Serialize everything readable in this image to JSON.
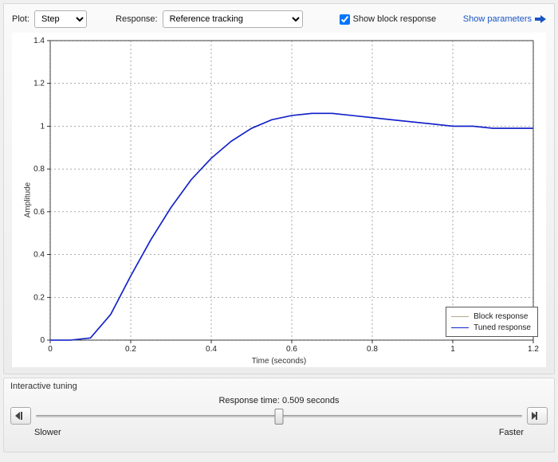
{
  "toolbar": {
    "plot_label": "Plot:",
    "plot_value": "Step",
    "response_label": "Response:",
    "response_value": "Reference tracking",
    "show_block_label": "Show block response",
    "show_block_checked": true,
    "show_params_label": "Show parameters"
  },
  "chart_data": {
    "type": "line",
    "title": "",
    "xlabel": "Time (seconds)",
    "ylabel": "Amplitude",
    "xlim": [
      0,
      1.2
    ],
    "ylim": [
      0,
      1.4
    ],
    "x": [
      0,
      0.05,
      0.1,
      0.15,
      0.2,
      0.25,
      0.3,
      0.35,
      0.4,
      0.45,
      0.5,
      0.55,
      0.6,
      0.65,
      0.7,
      0.75,
      0.8,
      0.85,
      0.9,
      0.95,
      1.0,
      1.05,
      1.1,
      1.15,
      1.2
    ],
    "series": [
      {
        "name": "Block response",
        "color": "#b8a98e",
        "values": [
          0,
          0,
          0.01,
          0.12,
          0.3,
          0.47,
          0.62,
          0.75,
          0.85,
          0.93,
          0.99,
          1.03,
          1.05,
          1.06,
          1.06,
          1.05,
          1.04,
          1.03,
          1.02,
          1.01,
          1.0,
          1.0,
          0.99,
          0.99,
          0.99
        ]
      },
      {
        "name": "Tuned response",
        "color": "#1020d0",
        "values": [
          0,
          0,
          0.01,
          0.12,
          0.3,
          0.47,
          0.62,
          0.75,
          0.85,
          0.93,
          0.99,
          1.03,
          1.05,
          1.06,
          1.06,
          1.05,
          1.04,
          1.03,
          1.02,
          1.01,
          1.0,
          1.0,
          0.99,
          0.99,
          0.99
        ]
      }
    ],
    "legend_position": "bottom-right",
    "xticks": [
      0,
      0.2,
      0.4,
      0.6,
      0.8,
      1.0,
      1.2
    ],
    "yticks": [
      0,
      0.2,
      0.4,
      0.6,
      0.8,
      1.0,
      1.2,
      1.4
    ]
  },
  "tuning": {
    "section_title": "Interactive tuning",
    "response_time_label": "Response time: 0.509 seconds",
    "slow_label": "Slower",
    "fast_label": "Faster"
  }
}
